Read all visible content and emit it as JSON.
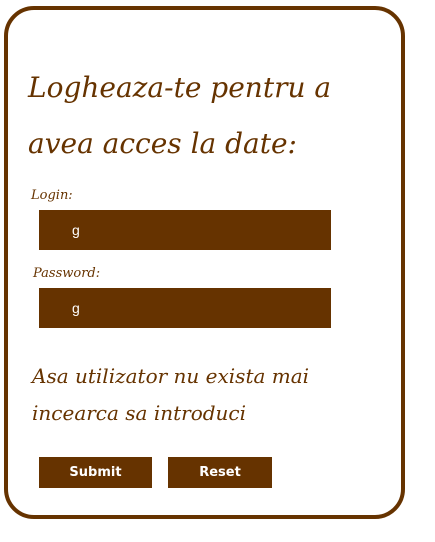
{
  "form": {
    "title": "Logheaza-te pentru a avea acces la date:",
    "login_label": "Login:",
    "login_value": "g",
    "password_label": "Password:",
    "password_value": "g",
    "error_message": "Asa utilizator nu exista mai incearca sa introduci",
    "submit_label": "Submit",
    "reset_label": "Reset"
  },
  "colors": {
    "accent": "#663300",
    "background": "#ffffff",
    "text_on_accent": "#ffffff"
  }
}
